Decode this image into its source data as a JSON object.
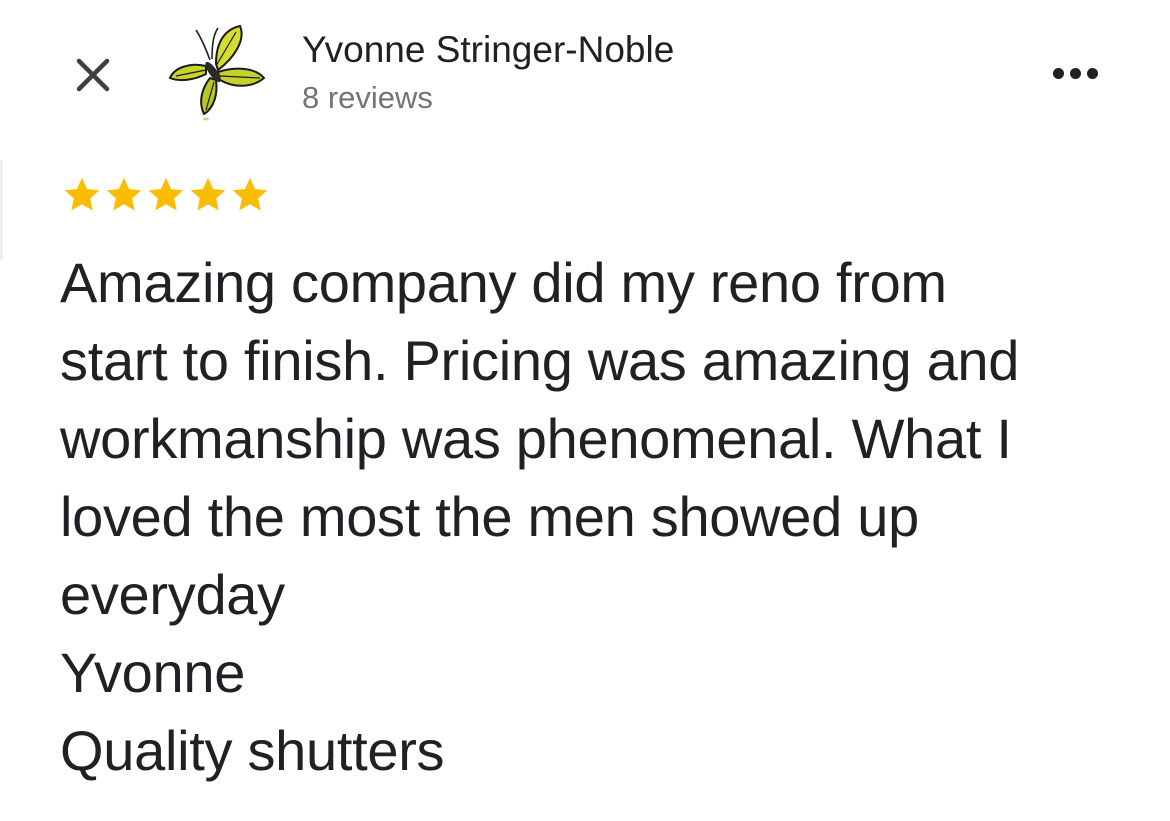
{
  "header": {
    "close_icon": "close-icon",
    "avatar_icon": "butterfly-avatar",
    "reviewer_name": "Yvonne Stringer-Noble",
    "review_count": "8 reviews",
    "more_icon": "more-horizontal-icon"
  },
  "review": {
    "rating": 5,
    "rating_max": 5,
    "star_color": "#fbbc04",
    "timestamp": "",
    "lines": [
      "Amazing company did my reno from",
      "start to finish. Pricing was amazing and",
      "workmanship was phenomenal. What I",
      "loved the most the men showed up",
      "everyday",
      "Yvonne",
      "Quality shutters"
    ]
  }
}
